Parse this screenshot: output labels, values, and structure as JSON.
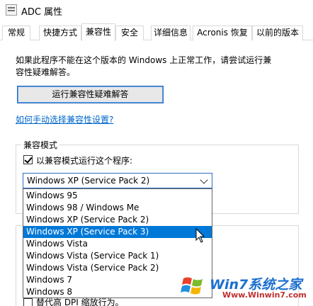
{
  "window": {
    "title": "ADC 属性"
  },
  "tabs": [
    {
      "label": "常规"
    },
    {
      "label": "快捷方式"
    },
    {
      "label": "兼容性"
    },
    {
      "label": "安全"
    },
    {
      "label": "详细信息"
    },
    {
      "label": "Acronis 恢复"
    },
    {
      "label": "以前的版本"
    }
  ],
  "active_tab": "兼容性",
  "compat": {
    "intro_line1": "如果此程序不能在这个版本的 Windows 上正常工作，请尝试运行兼",
    "intro_line2": "容性疑难解答。",
    "troubleshoot_button": "运行兼容性疑难解答",
    "manual_link": "如何手动选择兼容性设置?",
    "mode_group_label": "兼容模式",
    "run_compat_checkbox": "以兼容模式运行这个程序:",
    "run_compat_checked": true,
    "selected_os": "Windows XP (Service Pack 2)",
    "os_options": [
      "Windows 95",
      "Windows 98 / Windows Me",
      "Windows XP (Service Pack 2)",
      "Windows XP (Service Pack 3)",
      "Windows Vista",
      "Windows Vista (Service Pack 1)",
      "Windows Vista (Service Pack 2)",
      "Windows 7",
      "Windows 8"
    ],
    "highlighted_option": "Windows XP (Service Pack 3)",
    "dpi_checkbox_partial": "替代高 DPI 缩放行为。"
  },
  "watermark": {
    "brand": "Win7系统之家",
    "url": "Www.Winwin7.com"
  },
  "colors": {
    "accent": "#0078d7",
    "link": "#0066cc",
    "button_border": "#2d6cc0"
  },
  "icons": {
    "app": "window-properties-icon",
    "cursor": "mouse-pointer-icon",
    "dropdown": "chevron-down-icon"
  }
}
